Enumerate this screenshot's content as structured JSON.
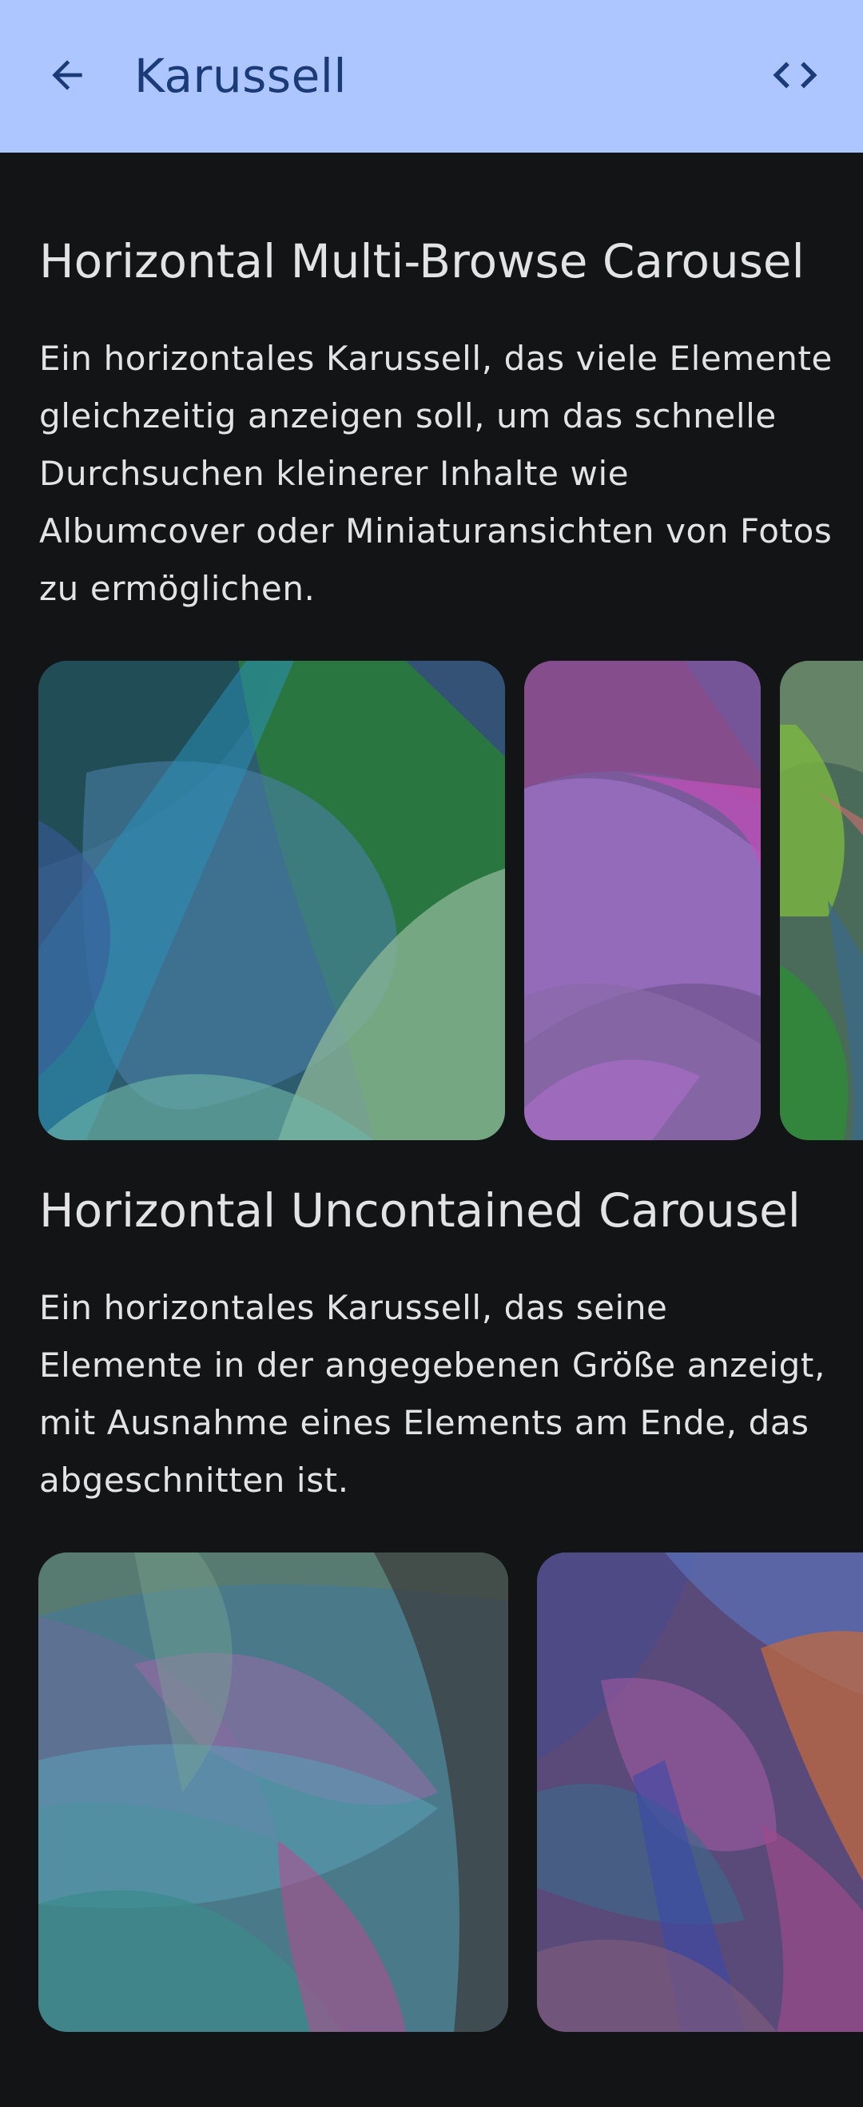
{
  "appbar": {
    "title": "Karussell",
    "back_icon": "arrow-back-icon",
    "code_icon": "code-icon",
    "background": "#adc6ff",
    "foreground": "#1a3a78"
  },
  "sections": [
    {
      "title": "Horizontal Multi-Browse Carousel",
      "description": "Ein horizontales Karussell, das viele Elemente gleichzeitig anzeigen soll, um das schnelle Durchsuchen kleinerer Inhalte wie Albumcover oder Miniaturansichten von Fotos zu ermöglichen."
    },
    {
      "title": "Horizontal Uncontained Carousel",
      "description": "Ein horizontales Karussell, das seine Elemente in der angegebenen Größe anzeigt, mit Ausnahme eines Elements am Ende, das abgeschnitten ist."
    }
  ],
  "theme": {
    "background": "#131416",
    "text": "#e3e3e6"
  }
}
